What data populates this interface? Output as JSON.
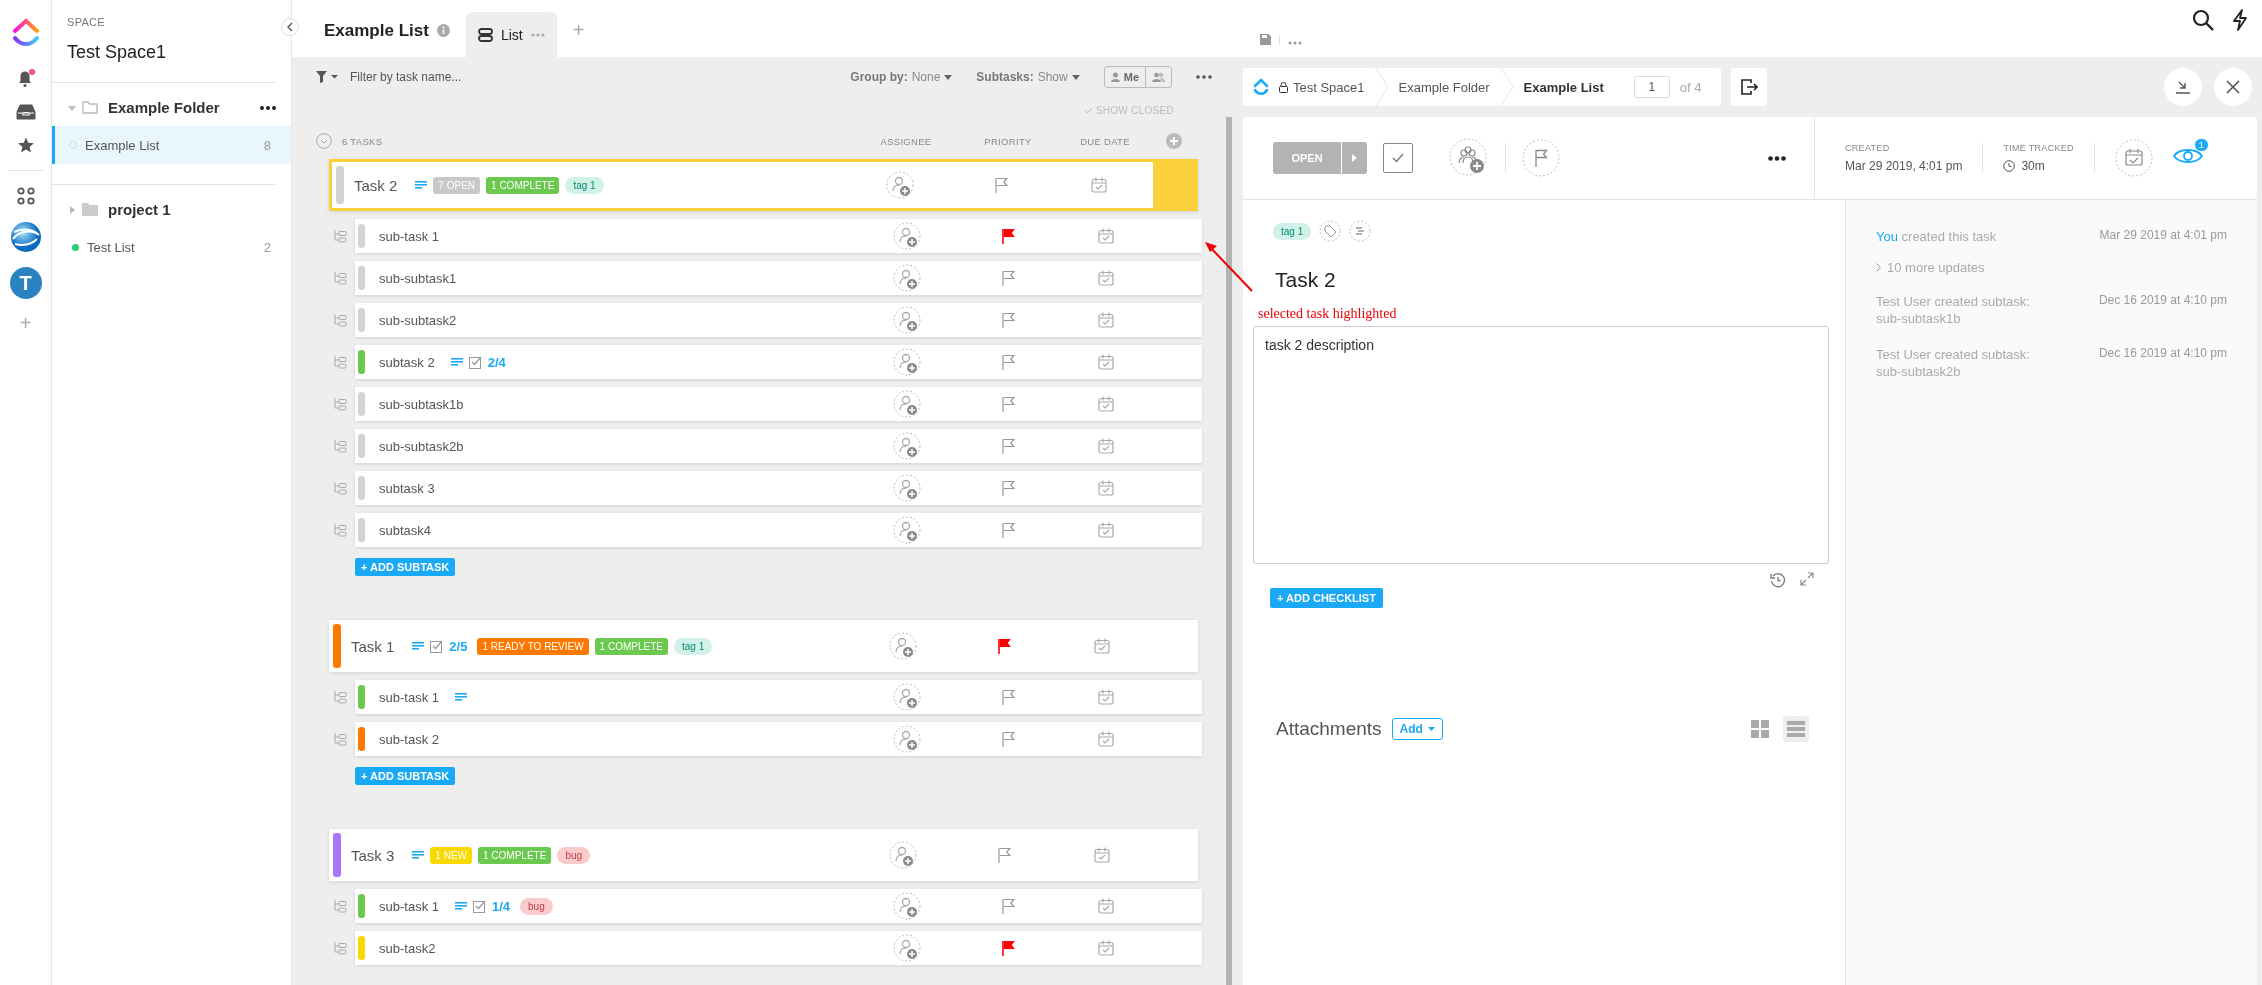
{
  "rail": {
    "avatar_initial": "T",
    "add": "+"
  },
  "sidebar": {
    "section_label": "SPACE",
    "space_name": "Test Space1",
    "items": [
      {
        "kind": "folder",
        "name": "Example Folder",
        "expanded": true,
        "children": [
          {
            "kind": "list",
            "name": "Example List",
            "count": "8",
            "selected": true
          }
        ]
      },
      {
        "kind": "folder",
        "name": "project 1",
        "expanded": false
      },
      {
        "kind": "list",
        "name": "Test List",
        "count": "2",
        "selected": false,
        "color": "#2ecd6f"
      }
    ]
  },
  "header": {
    "title": "Example List",
    "views": [
      {
        "label": "List",
        "selected": true
      }
    ],
    "add": "+"
  },
  "toolbar": {
    "filter_placeholder": "Filter by task name...",
    "group_by_label": "Group by:",
    "group_by_value": "None",
    "subtasks_label": "Subtasks:",
    "subtasks_value": "Show",
    "me": "Me",
    "show_closed": "SHOW CLOSED"
  },
  "list": {
    "count_label": "6 TASKS",
    "columns": [
      "ASSIGNEE",
      "PRIORITY",
      "DUE DATE"
    ]
  },
  "tasks": [
    {
      "name": "Task 2",
      "color": "#d3d3d3",
      "selected": true,
      "add_subtask": "+ ADD SUBTASK",
      "flagged": false,
      "description": true,
      "labels": [
        {
          "kind": "status",
          "text": "7 OPEN",
          "color": "#c8c8c8"
        },
        {
          "kind": "status",
          "text": "1 COMPLETE",
          "color": "#6bc950"
        },
        {
          "kind": "tag",
          "text": "tag 1",
          "color": "#d2f1e8"
        }
      ],
      "subtasks": [
        {
          "name": "sub-task 1",
          "color": "#d3d3d3",
          "flagged": true
        },
        {
          "name": "sub-subtask1",
          "color": "#d3d3d3",
          "flagged": false
        },
        {
          "name": "sub-subtask2",
          "color": "#d3d3d3",
          "flagged": false
        },
        {
          "name": "subtask 2",
          "color": "#6bc950",
          "flagged": false,
          "description": true,
          "checklist": "2/4"
        },
        {
          "name": "sub-subtask1b",
          "color": "#d3d3d3",
          "flagged": false
        },
        {
          "name": "sub-subtask2b",
          "color": "#d3d3d3",
          "flagged": false
        },
        {
          "name": "subtask 3",
          "color": "#d3d3d3",
          "flagged": false
        },
        {
          "name": "subtask4",
          "color": "#d3d3d3",
          "flagged": false
        }
      ]
    },
    {
      "name": "Task 1",
      "color": "#ff7800",
      "selected": false,
      "add_subtask": "+ ADD SUBTASK",
      "flagged": true,
      "description": true,
      "checklist": "2/5",
      "labels": [
        {
          "kind": "status",
          "text": "1 READY TO REVIEW",
          "color": "#ff7800"
        },
        {
          "kind": "status",
          "text": "1 COMPLETE",
          "color": "#6bc950"
        },
        {
          "kind": "tag",
          "text": "tag 1",
          "color": "#d2f1e8"
        }
      ],
      "subtasks": [
        {
          "name": "sub-task 1",
          "color": "#6bc950",
          "flagged": false,
          "description": true
        },
        {
          "name": "sub-task 2",
          "color": "#ff7800",
          "flagged": false
        }
      ]
    },
    {
      "name": "Task 3",
      "color": "#a875ff",
      "selected": false,
      "flagged": false,
      "description": true,
      "labels": [
        {
          "kind": "status",
          "text": "1 NEW",
          "color": "#f9d900"
        },
        {
          "kind": "status",
          "text": "1 COMPLETE",
          "color": "#6bc950"
        },
        {
          "kind": "tag",
          "text": "bug",
          "color": "#fbcaca"
        }
      ],
      "subtasks": [
        {
          "name": "sub-task 1",
          "color": "#6bc950",
          "flagged": false,
          "description": true,
          "checklist": "1/4",
          "labels": [
            {
              "kind": "tag",
              "text": "bug",
              "color": "#fbcaca"
            }
          ]
        },
        {
          "name": "sub-task2",
          "color": "#f9d900",
          "flagged": true
        }
      ]
    }
  ],
  "detail": {
    "breadcrumb": [
      "Test Space1",
      "Example Folder",
      "Example List"
    ],
    "page": "1",
    "page_total": "of 4",
    "status": "OPEN",
    "created_label": "CREATED",
    "created_value": "Mar 29 2019, 4:01 pm",
    "time_label": "TIME TRACKED",
    "time_value": "30m",
    "watchers": "1",
    "tags": [
      "tag 1"
    ],
    "title": "Task 2",
    "description": "task 2 description",
    "add_checklist": "+ ADD CHECKLIST",
    "attachments_label": "Attachments",
    "attachments_add": "Add",
    "attachment_views": [
      {
        "kind": "grid",
        "selected": false
      },
      {
        "kind": "list",
        "selected": true
      }
    ],
    "activity": [
      {
        "kind": "event",
        "actor": "You",
        "text": "created this task",
        "time": "Mar 29 2019 at 4:01 pm"
      },
      {
        "kind": "more",
        "text": "10 more updates"
      },
      {
        "kind": "event",
        "text": "Test User created subtask: sub-subtask1b",
        "time": "Dec 16 2019 at 4:10 pm"
      },
      {
        "kind": "event",
        "text": "Test User created subtask: sub-subtask2b",
        "time": "Dec 16 2019 at 4:10 pm"
      }
    ]
  },
  "annotation": {
    "text": "selected task highlighted"
  }
}
